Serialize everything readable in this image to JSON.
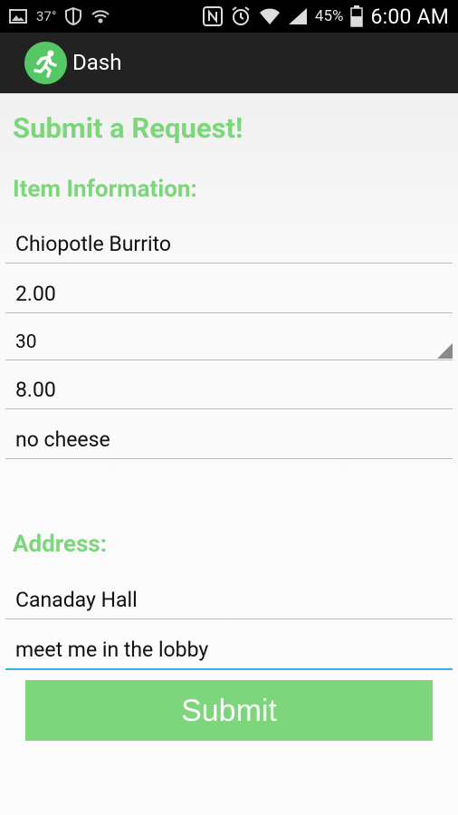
{
  "status_bar": {
    "temperature": "37°",
    "battery_percent": "45%",
    "time": "6:00 AM"
  },
  "action_bar": {
    "title": "Dash"
  },
  "form": {
    "title": "Submit a Request!",
    "item_heading": "Item Information:",
    "item_name": "Chiopotle Burrito",
    "price": "2.00",
    "quantity_selected": "30",
    "tip": "8.00",
    "notes": "no cheese",
    "address_heading": "Address:",
    "location": "Canaday Hall",
    "instructions": "meet me in the lobby",
    "submit_label": "Submit"
  },
  "colors": {
    "accent": "#7dd67c",
    "focus_underline": "#33b5e5",
    "action_bar": "#222222"
  }
}
